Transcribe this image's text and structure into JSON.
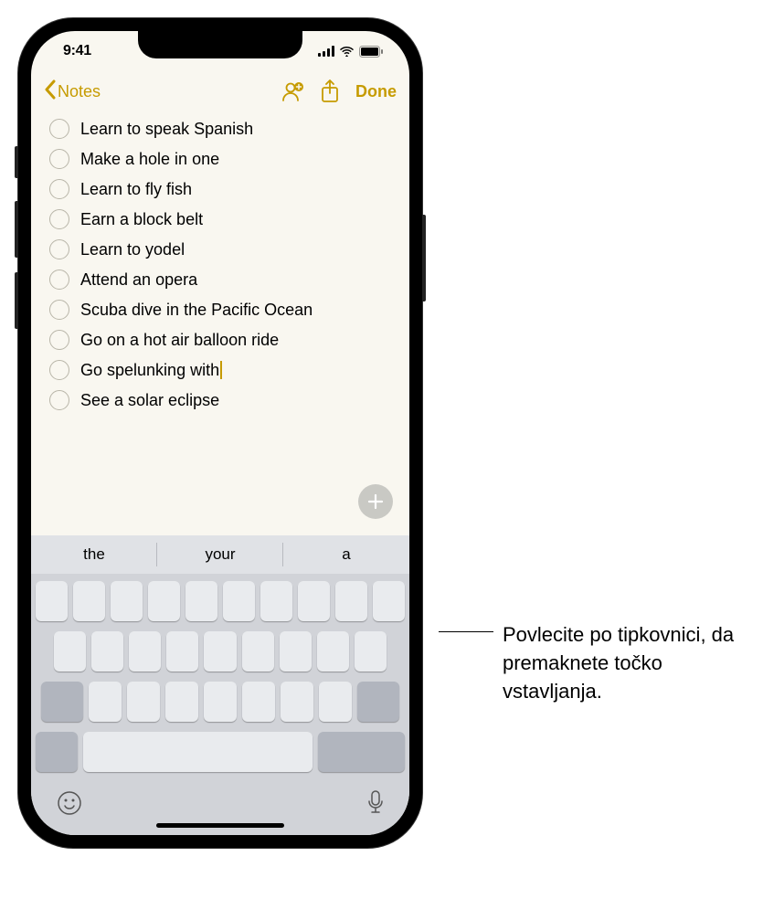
{
  "status": {
    "time": "9:41"
  },
  "nav": {
    "back_label": "Notes",
    "done_label": "Done"
  },
  "checklist": [
    "Learn to speak Spanish",
    "Make a hole in one",
    "Learn to fly fish",
    "Earn a block belt",
    "Learn to yodel",
    "Attend an opera",
    "Scuba dive in the Pacific Ocean",
    "Go on a hot air balloon ride",
    "Go spelunking with",
    "See a solar eclipse"
  ],
  "cursor_index": 8,
  "suggestions": [
    "the",
    "your",
    "a"
  ],
  "callout": "Povlecite po tipkovnici, da premaknete točko vstavljanja."
}
